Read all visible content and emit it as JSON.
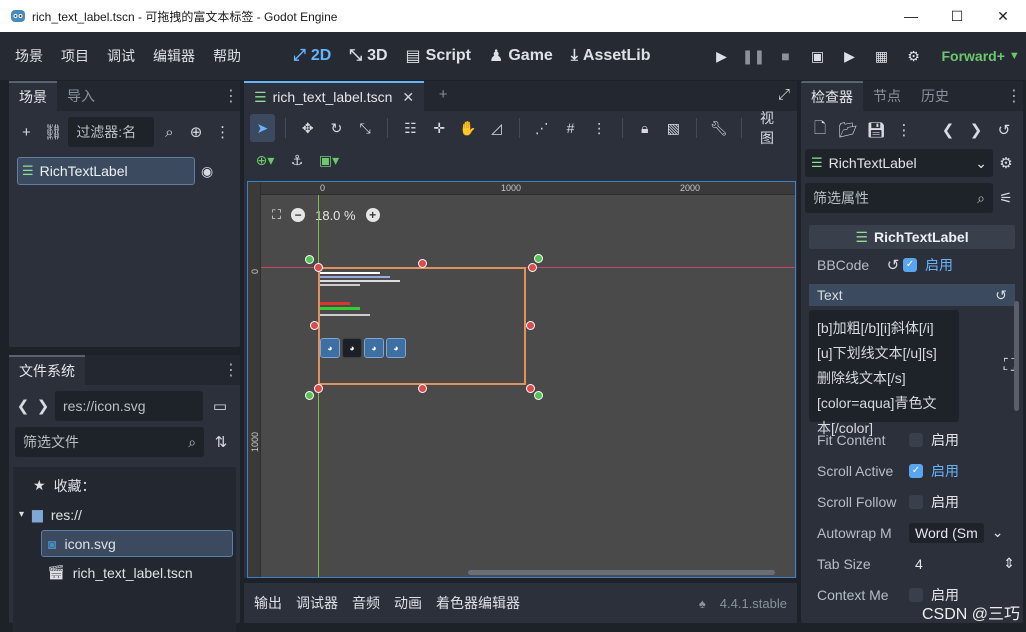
{
  "window": {
    "title": "rich_text_label.tscn - 可拖拽的富文本标签 - Godot Engine",
    "controls": [
      "—",
      "☐",
      "✕"
    ]
  },
  "menubar": {
    "menus": [
      "场景",
      "项目",
      "调试",
      "编辑器",
      "帮助"
    ],
    "workspaces": [
      {
        "label": "2D",
        "icon": "2d-icon",
        "active": true
      },
      {
        "label": "3D",
        "icon": "3d-icon",
        "active": false
      },
      {
        "label": "Script",
        "icon": "script-icon",
        "active": false
      },
      {
        "label": "Game",
        "icon": "game-icon",
        "active": false
      },
      {
        "label": "AssetLib",
        "icon": "assetlib-icon",
        "active": false
      }
    ],
    "renderer": "Forward+"
  },
  "scene_dock": {
    "tabs": [
      "场景",
      "导入"
    ],
    "filter_placeholder": "过滤器:名",
    "root_node": "RichTextLabel"
  },
  "filesystem_dock": {
    "tab": "文件系统",
    "path": "res://icon.svg",
    "filter_placeholder": "筛选文件",
    "favorites": "收藏：",
    "root": "res://",
    "files": [
      "icon.svg",
      "rich_text_label.tscn"
    ]
  },
  "editor": {
    "tab": "rich_text_label.tscn",
    "view_menu": "视图",
    "zoom": "18.0 %",
    "ruler_h": [
      "0",
      "1000",
      "2000"
    ],
    "ruler_v": [
      "0",
      "1000"
    ]
  },
  "bottom_panel": {
    "tabs": [
      "输出",
      "调试器",
      "音频",
      "动画",
      "着色器编辑器"
    ],
    "version": "4.4.1.stable"
  },
  "inspector": {
    "tabs": [
      "检查器",
      "节点",
      "历史"
    ],
    "node": "RichTextLabel",
    "filter_placeholder": "筛选属性",
    "class_header": "RichTextLabel",
    "bbcode": {
      "name": "BBCode",
      "label": "启用",
      "checked": true
    },
    "text_section": "Text",
    "text_lines": [
      "[b]加粗[/b][i]斜体[/i]",
      "[u]下划线文本[/u][s]",
      "删除线文本[/s]",
      "[color=aqua]青色文",
      "本[/color]"
    ],
    "properties": [
      {
        "name": "Fit Content",
        "type": "check",
        "label": "启用",
        "checked": false
      },
      {
        "name": "Scroll Active",
        "type": "check",
        "label": "启用",
        "checked": true
      },
      {
        "name": "Scroll Follow",
        "type": "check",
        "label": "启用",
        "checked": false
      },
      {
        "name": "Autowrap M",
        "type": "dropdown",
        "value": "Word (Sm"
      },
      {
        "name": "Tab Size",
        "type": "number",
        "value": "4"
      },
      {
        "name": "Context Me",
        "type": "check",
        "label": "启用",
        "checked": false
      }
    ]
  },
  "watermark": "CSDN @三巧",
  "colors": {
    "accent": "#66b3ff",
    "renderer": "#6ec66e",
    "panel": "#2b303a",
    "bg": "#1d2128"
  }
}
